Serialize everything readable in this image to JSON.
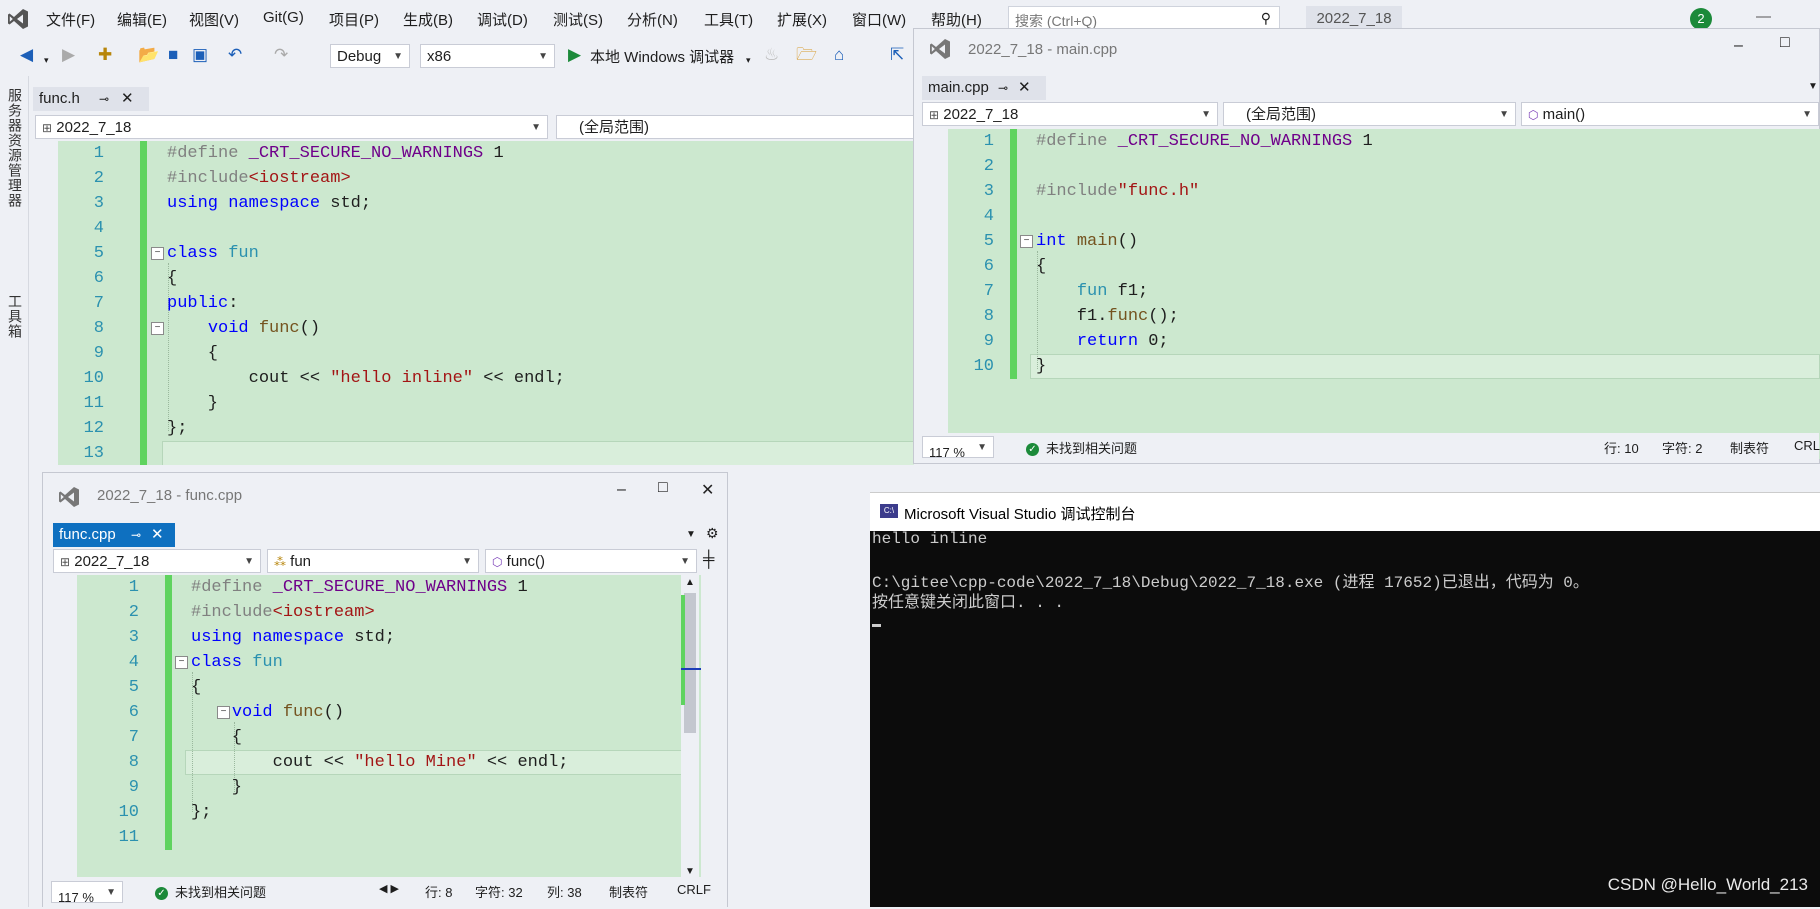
{
  "menu": [
    "文件(F)",
    "编辑(E)",
    "视图(V)",
    "Git(G)",
    "项目(P)",
    "生成(B)",
    "调试(D)",
    "测试(S)",
    "分析(N)",
    "工具(T)",
    "扩展(X)",
    "窗口(W)",
    "帮助(H)"
  ],
  "search_placeholder": "搜索 (Ctrl+Q)",
  "solution_title": "2022_7_18",
  "notification_count": "2",
  "toolbar": {
    "config": "Debug",
    "platform": "x86",
    "run_label": "本地 Windows 调试器"
  },
  "side_panels": [
    "服务器资源管理器",
    "工具箱"
  ],
  "func_h": {
    "tab": "func.h",
    "nav_project": "2022_7_18",
    "nav_scope": "(全局范围)",
    "lines": [
      "1",
      "2",
      "3",
      "4",
      "5",
      "6",
      "7",
      "8",
      "9",
      "10",
      "11",
      "12",
      "13"
    ]
  },
  "main_cpp": {
    "window_title": "2022_7_18 - main.cpp",
    "tab": "main.cpp",
    "nav_project": "2022_7_18",
    "nav_scope": "(全局范围)",
    "nav_member": "main()",
    "lines": [
      "1",
      "2",
      "3",
      "4",
      "5",
      "6",
      "7",
      "8",
      "9",
      "10"
    ],
    "zoom": "117 %",
    "issues": "未找到相关问题",
    "row": "行: 10",
    "char": "字符: 2",
    "tab_mode": "制表符",
    "eol": "CRL"
  },
  "func_cpp": {
    "window_title": "2022_7_18 - func.cpp",
    "tab": "func.cpp",
    "nav_project": "2022_7_18",
    "nav_scope": "fun",
    "nav_member": "func()",
    "lines": [
      "1",
      "2",
      "3",
      "4",
      "5",
      "6",
      "7",
      "8",
      "9",
      "10",
      "11"
    ],
    "zoom": "117 %",
    "issues": "未找到相关问题",
    "row": "行: 8",
    "char": "字符: 32",
    "col": "列: 38",
    "tab_mode": "制表符",
    "eol": "CRLF"
  },
  "console": {
    "title": "Microsoft Visual Studio 调试控制台",
    "output": [
      "hello inline",
      "",
      "C:\\gitee\\cpp-code\\2022_7_18\\Debug\\2022_7_18.exe (进程 17652)已退出，代码为 0。",
      "按任意键关闭此窗口. . ."
    ]
  },
  "watermark": "CSDN @Hello_World_213"
}
